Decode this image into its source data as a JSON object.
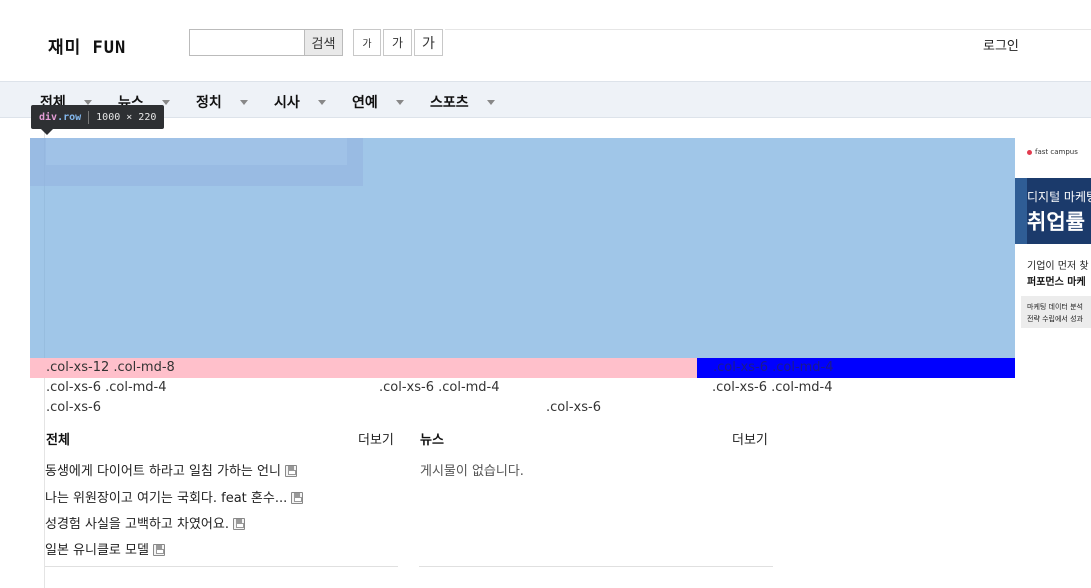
{
  "header": {
    "logo": "재미 FUN",
    "search_placeholder": "",
    "search_button": "검색",
    "font_buttons": [
      "가",
      "가",
      "가"
    ],
    "login": "로그인"
  },
  "nav": {
    "items": [
      "전체",
      "뉴스",
      "정치",
      "시사",
      "연예",
      "스포츠"
    ]
  },
  "devtools": {
    "tag": "div",
    "class": ".row",
    "size": "1000 × 220"
  },
  "grid": {
    "row1": [
      ".col-xs-12 .col-md-8",
      ".col-xs-6 .col-md-4"
    ],
    "row2": [
      ".col-xs-6 .col-md-4",
      ".col-xs-6 .col-md-4",
      ".col-xs-6 .col-md-4"
    ],
    "row3": [
      ".col-xs-6",
      ".col-xs-6"
    ]
  },
  "boards": [
    {
      "title": "전체",
      "more": "더보기",
      "posts": [
        "동생에게 다이어트 하라고 일침 가하는 언니",
        "나는 위원장이고 여기는 국회다. feat 혼수...",
        "성경험 사실을 고백하고 차였어요.",
        "일본 유니클로 모델"
      ]
    },
    {
      "title": "뉴스",
      "more": "더보기",
      "empty": "게시물이 없습니다."
    }
  ],
  "ad": {
    "brand": "fast campus",
    "headline1": "디지털 마케팅",
    "headline2": "취업률",
    "text1": "기업이 먼저 찾",
    "text2": "퍼포먼스 마케",
    "small1": "마케팅 데이터 분석",
    "small2": "전략 수립에서 성과"
  },
  "colors": {
    "highlight": "#6fa8dc",
    "pink_col": "#ffc0cb",
    "blue_col": "#0000ff",
    "nav_bg": "#eef2f7",
    "ad_banner": "#1b3a6b"
  }
}
